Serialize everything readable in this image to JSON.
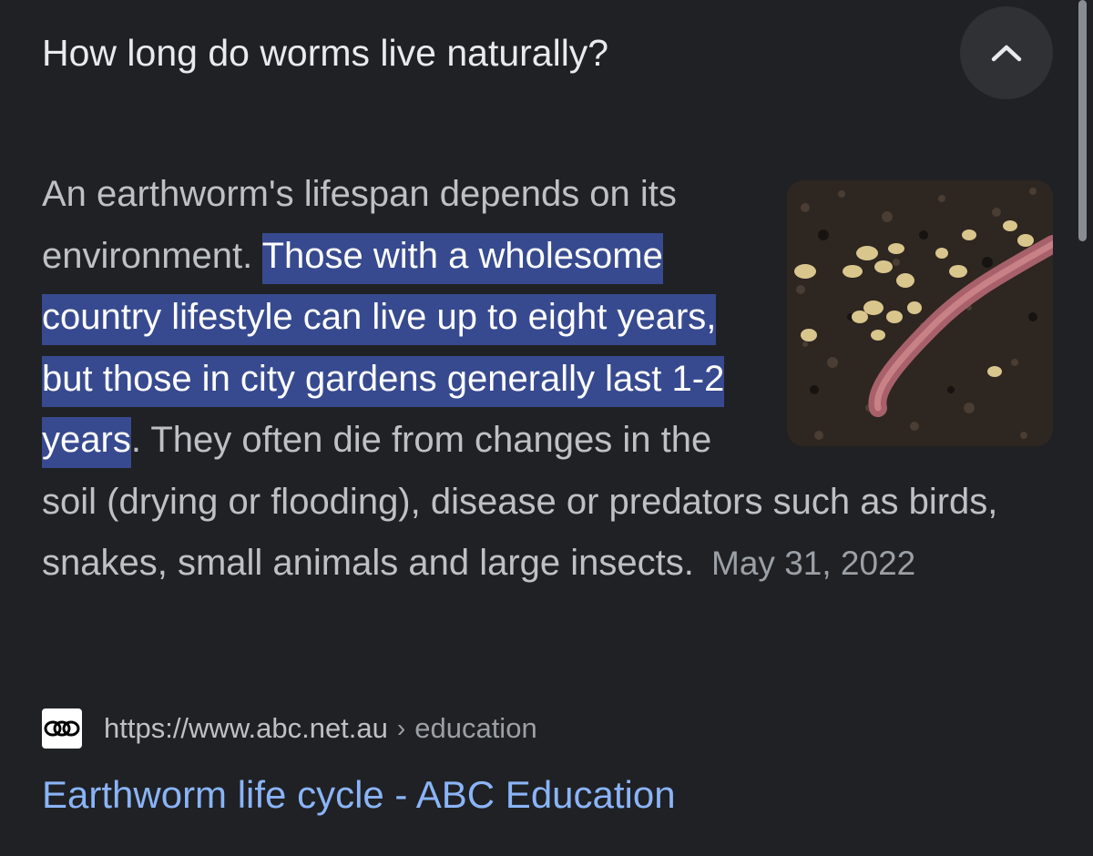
{
  "question": "How long do worms live naturally?",
  "collapse_icon": "chevron-up-icon",
  "snippet": {
    "intro": "An earthworm's lifespan depends on its environment. ",
    "highlight": "Those with a wholesome country lifestyle can live up to eight years, but those in city gardens generally last 1-2 years",
    "period": ".",
    "rest": " They often die from changes in the soil (drying or flooding), disease or predators such as birds, snakes, small animals and large insects.",
    "date": "May 31, 2022",
    "image": "earthworm-in-soil-image"
  },
  "source": {
    "favicon": "abc-logo-icon",
    "url": "https://www.abc.net.au",
    "separator": "›",
    "crumb": "education"
  },
  "result_title": "Earthworm life cycle - ABC Education",
  "colors": {
    "background": "#202124",
    "highlight_bg": "#374a8f",
    "link": "#8ab4f8",
    "body_text": "#bdc1c6",
    "muted": "#9aa0a6"
  }
}
